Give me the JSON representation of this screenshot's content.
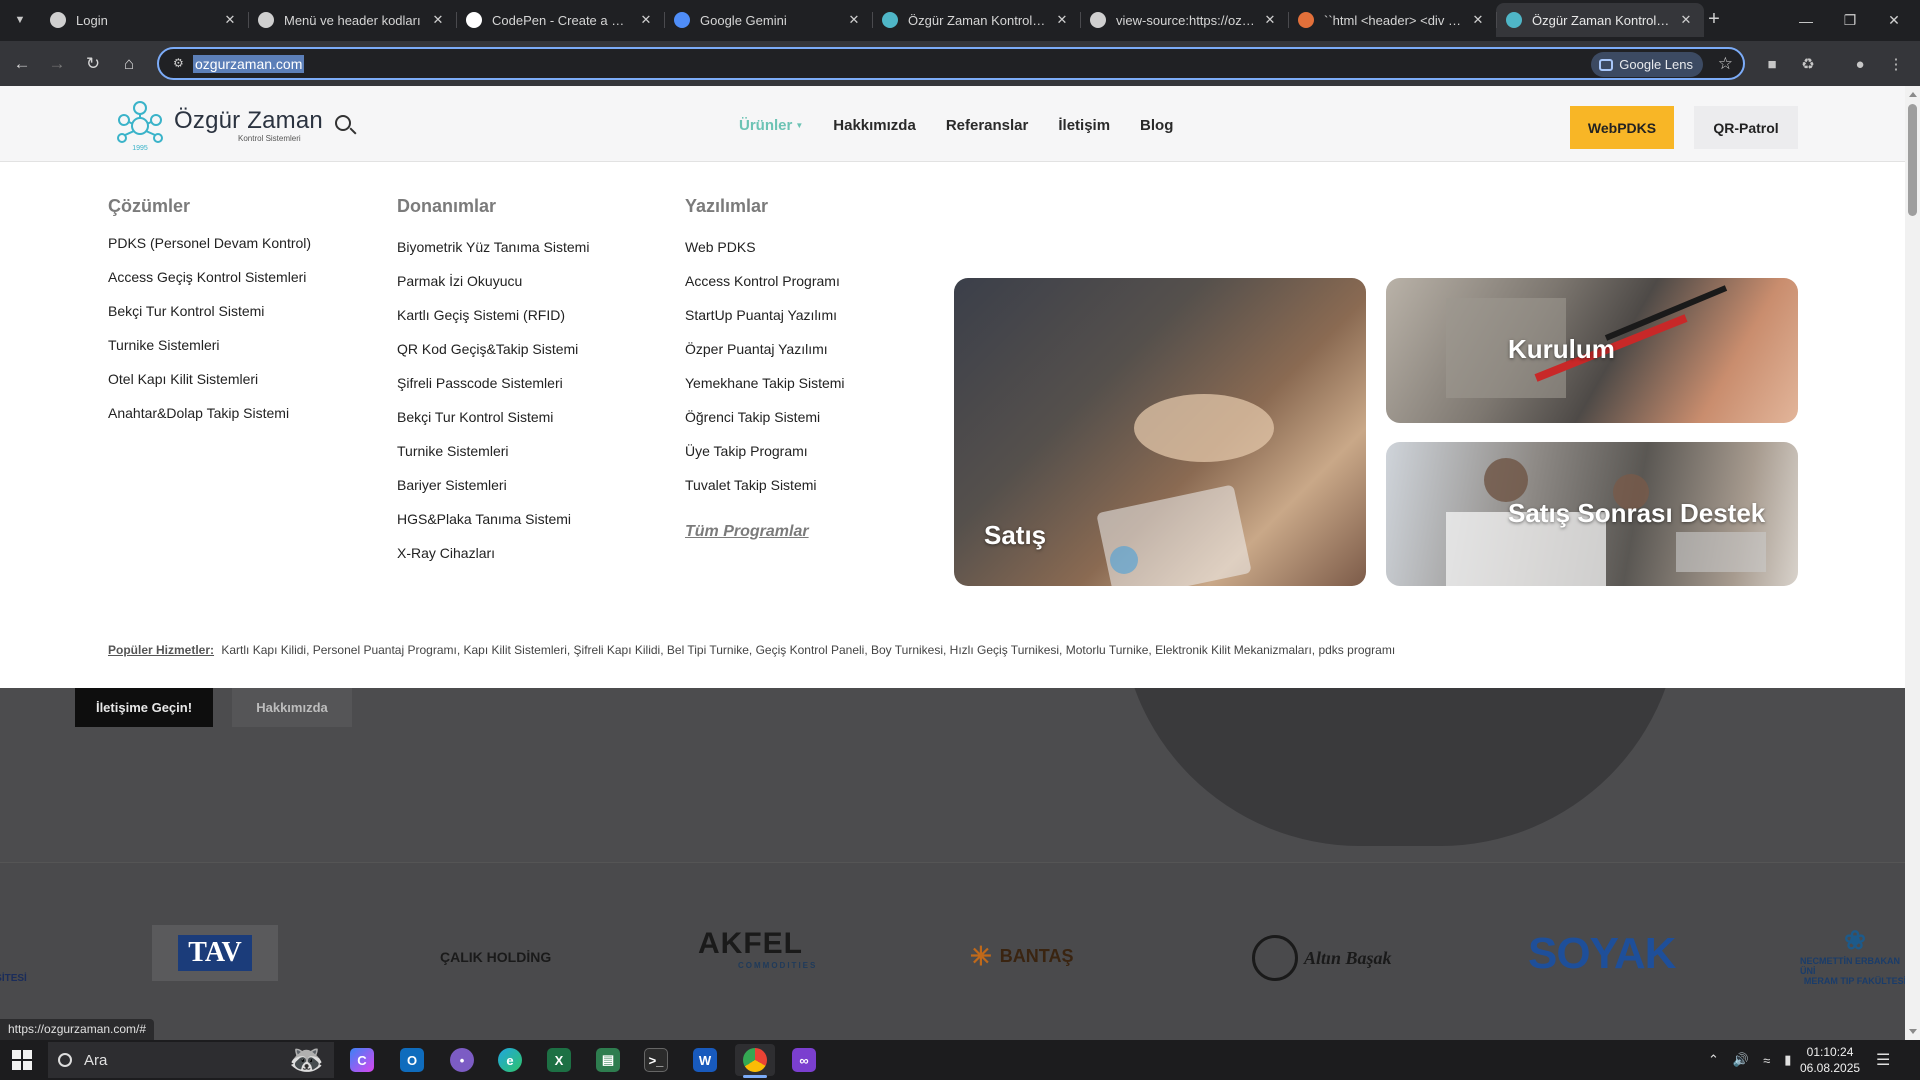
{
  "browser": {
    "tabs": [
      {
        "title": "Login",
        "favicon": "globe-icon",
        "color": "#cfcfcf"
      },
      {
        "title": "Menü ve header kodları",
        "favicon": "chatgpt-icon",
        "color": "#cfcfcf"
      },
      {
        "title": "CodePen - Create a New Pen",
        "favicon": "codepen-icon",
        "color": "#ffffff"
      },
      {
        "title": "Google Gemini",
        "favicon": "gemini-icon",
        "color": "#4f8df7"
      },
      {
        "title": "Özgür Zaman Kontrol Sistemleri",
        "favicon": "ozgur-zaman-icon",
        "color": "#4fb6c7"
      },
      {
        "title": "view-source:https://ozgurzaman.com",
        "favicon": "globe-icon",
        "color": "#cfcfcf"
      },
      {
        "title": "``html <header> <div class",
        "favicon": "claude-icon",
        "color": "#e2703a"
      },
      {
        "title": "Özgür Zaman Kontrol Sistemleri",
        "favicon": "ozgur-zaman-icon",
        "color": "#4fb6c7",
        "active": true
      }
    ],
    "new_tab": "+",
    "url": "ozgurzaman.com",
    "lens_label": "Google Lens"
  },
  "header": {
    "logo_brand": "Özgür Zaman",
    "logo_sub": "Kontrol Sistemleri",
    "logo_year": "1995",
    "nav": [
      {
        "label": "Ürünler",
        "active": true,
        "has_caret": true
      },
      {
        "label": "Hakkımızda"
      },
      {
        "label": "Referanslar"
      },
      {
        "label": "İletişim"
      },
      {
        "label": "Blog"
      }
    ],
    "btn_webpdks": "WebPDKS",
    "btn_qr": "QR-Patrol"
  },
  "mega_menu": {
    "solutions": {
      "title": "Çözümler",
      "items": [
        "PDKS (Personel Devam Kontrol)",
        "Access Geçiş Kontrol Sistemleri",
        "Bekçi Tur Kontrol Sistemi",
        "Turnike Sistemleri",
        "Otel Kapı Kilit Sistemleri",
        "Anahtar&Dolap Takip Sistemi"
      ]
    },
    "hardware": {
      "title": "Donanımlar",
      "items": [
        "Biyometrik Yüz Tanıma Sistemi",
        "Parmak İzi Okuyucu",
        "Kartlı Geçiş Sistemi (RFID)",
        "QR Kod Geçiş&Takip Sistemi",
        "Şifreli Passcode Sistemleri",
        "Bekçi Tur Kontrol Sistemi",
        "Turnike Sistemleri",
        "Bariyer Sistemleri",
        "HGS&Plaka Tanıma Sistemi",
        "X-Ray Cihazları"
      ]
    },
    "software": {
      "title": "Yazılımlar",
      "items": [
        "Web PDKS",
        "Access Kontrol Programı",
        "StartUp Puantaj Yazılımı",
        "Özper Puantaj Yazılımı",
        "Yemekhane Takip Sistemi",
        "Öğrenci Takip Sistemi",
        "Üye Takip Programı",
        "Tuvalet Takip Sistemi"
      ],
      "all_link": "Tüm Programlar"
    },
    "cards": {
      "sales": "Satış",
      "install": "Kurulum",
      "support": "Satış Sonrası Destek"
    },
    "popular_label": "Popüler Hizmetler:",
    "popular_text": "Kartlı Kapı Kilidi, Personel Puantaj Programı, Kapı Kilit Sistemleri, Şifreli Kapı Kilidi, Bel Tipi Turnike, Geçiş Kontrol Paneli, Boy Turnikesi, Hızlı Geçiş Turnikesi, Motorlu Turnike,  Elektronik Kilit Mekanizmaları, pdks programı"
  },
  "hero": {
    "btn_contact": "İletişime Geçin!",
    "btn_about": "Hakkımızda"
  },
  "partners": [
    "SİTESİ",
    "TAV",
    "ÇALIK HOLDİNG",
    "AKFEL",
    "COMMODITIES",
    "BANTAŞ",
    "Altın Başak",
    "SOYAK",
    "NECMETTİN ERBAKAN ÜNİ",
    "MERAM TIP FAKÜLTESİ"
  ],
  "status_url": "https://ozgurzaman.com/#",
  "taskbar": {
    "search_placeholder": "Ara",
    "time": "01:10:24",
    "date": "06.08.2025"
  }
}
